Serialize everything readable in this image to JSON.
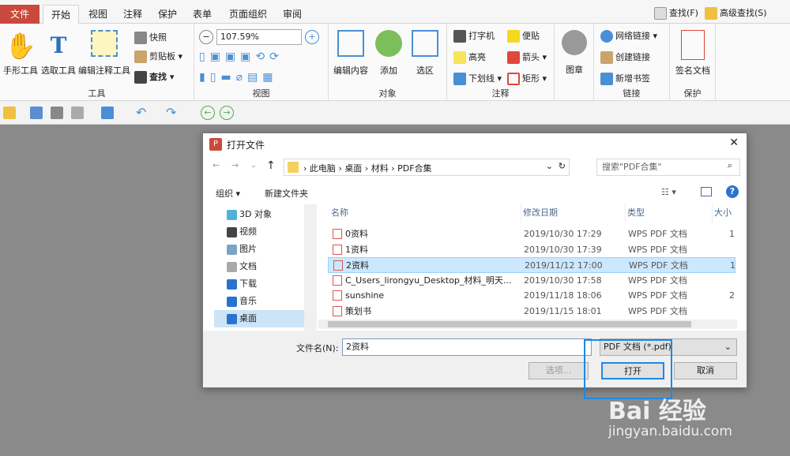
{
  "tabs": {
    "file": "文件",
    "start": "开始",
    "view": "视图",
    "annotate": "注释",
    "protect": "保护",
    "form": "表单",
    "page_org": "页面组织",
    "review": "审阅"
  },
  "top_right": {
    "find": "查找(F)",
    "adv_find": "高级查找(S)"
  },
  "ribbon": {
    "tools": {
      "hand": "手形工具",
      "select": "选取工具",
      "edit_annot": "编辑注释工具",
      "snapshot": "快照",
      "clipboard": "剪贴板",
      "find": "查找",
      "label": "工具"
    },
    "view": {
      "zoom": "107.59%",
      "label": "视图"
    },
    "object": {
      "edit": "编辑内容",
      "add": "添加",
      "region": "选区",
      "label": "对象"
    },
    "annot": {
      "typewriter": "打字机",
      "note": "便贴",
      "highlight": "高亮",
      "arrow": "箭头",
      "underline": "下划线",
      "rect": "矩形",
      "label": "注释"
    },
    "image": {
      "label": "图章"
    },
    "link": {
      "web": "网络链接",
      "create": "创建链接",
      "bookmark": "新增书签",
      "label": "链接"
    },
    "protect": {
      "sign": "签名文档",
      "label": "保护"
    }
  },
  "dialog": {
    "title": "打开文件",
    "breadcrumb": [
      "此电脑",
      "桌面",
      "材料",
      "PDF合集"
    ],
    "search_placeholder": "搜索\"PDF合集\"",
    "organize": "组织",
    "new_folder": "新建文件夹",
    "nav": [
      "3D 对象",
      "视频",
      "图片",
      "文档",
      "下载",
      "音乐",
      "桌面"
    ],
    "columns": {
      "name": "名称",
      "modified": "修改日期",
      "type": "类型",
      "size": "大小"
    },
    "files": [
      {
        "name": "0资料",
        "date": "2019/10/30 17:29",
        "type": "WPS PDF 文档",
        "size": "1"
      },
      {
        "name": "1资料",
        "date": "2019/10/30 17:39",
        "type": "WPS PDF 文档",
        "size": ""
      },
      {
        "name": "2资料",
        "date": "2019/11/12 17:00",
        "type": "WPS PDF 文档",
        "size": "1"
      },
      {
        "name": "C_Users_lirongyu_Desktop_材料_明天...",
        "date": "2019/10/30 17:58",
        "type": "WPS PDF 文档",
        "size": ""
      },
      {
        "name": "sunshine",
        "date": "2019/11/18 18:06",
        "type": "WPS PDF 文档",
        "size": "2"
      },
      {
        "name": "策划书",
        "date": "2019/11/15 18:01",
        "type": "WPS PDF 文档",
        "size": ""
      }
    ],
    "filename_label": "文件名(N):",
    "filename_value": "2资料",
    "filter": "PDF 文档 (*.pdf)",
    "options": "选项...",
    "open": "打开",
    "cancel": "取消"
  },
  "watermark": {
    "brand": "Bai 经验",
    "url": "jingyan.baidu.com"
  },
  "colors": {
    "accent": "#c94a3d",
    "highlight": "#1e88e5",
    "selection": "#cce8ff"
  }
}
